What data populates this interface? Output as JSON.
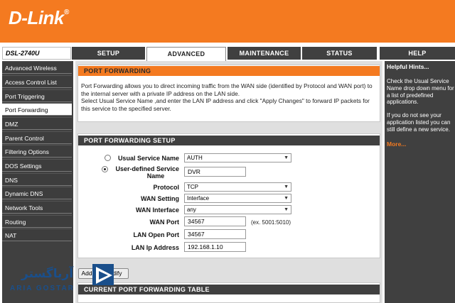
{
  "brand": {
    "logo": "D-Link",
    "logo_mark": "®"
  },
  "model": "DSL-2740U",
  "tabs": [
    {
      "label": "SETUP"
    },
    {
      "label": "ADVANCED"
    },
    {
      "label": "MAINTENANCE"
    },
    {
      "label": "STATUS"
    },
    {
      "label": "HELP"
    }
  ],
  "sidebar": {
    "items": [
      {
        "label": "Advanced Wireless"
      },
      {
        "label": "Access Control List"
      },
      {
        "label": "Port Triggering"
      },
      {
        "label": "Port Forwarding"
      },
      {
        "label": "DMZ"
      },
      {
        "label": "Parent Control"
      },
      {
        "label": "Filtering Options"
      },
      {
        "label": "DOS Settings"
      },
      {
        "label": "DNS"
      },
      {
        "label": "Dynamic DNS"
      },
      {
        "label": "Network Tools"
      },
      {
        "label": "Routing"
      },
      {
        "label": "NAT"
      }
    ]
  },
  "port_forwarding": {
    "title": "PORT FORWARDING",
    "intro_1": "Port Forwarding allows you to direct incoming traffic from the WAN side (identified by Protocol and WAN port) to the internal server with a private IP address on the LAN side.",
    "intro_2": "Select Usual Service Name ,and enter the LAN IP address and click \"Apply Changes\" to forward IP packets for this service to the specified server."
  },
  "setup": {
    "title": "PORT FORWARDING SETUP",
    "usual_service_label": "Usual Service Name",
    "usual_service_value": "AUTH",
    "user_defined_label_1": "User-defined Service",
    "user_defined_label_2": "Name",
    "user_defined_value": "DVR",
    "protocol_label": "Protocol",
    "protocol_value": "TCP",
    "wan_setting_label": "WAN Setting",
    "wan_setting_value": "Interface",
    "wan_interface_label": "WAN Interface",
    "wan_interface_value": "any",
    "wan_port_label": "WAN Port",
    "wan_port_value": "34567",
    "wan_port_hint": "(ex. 5001:5010)",
    "lan_open_port_label": "LAN Open Port",
    "lan_open_port_value": "34567",
    "lan_ip_label": "LAN Ip Address",
    "lan_ip_value": "192.168.1.10"
  },
  "buttons": {
    "add": "Add",
    "modify": "Modify"
  },
  "table": {
    "title": "CURRENT PORT FORWARDING TABLE"
  },
  "help": {
    "title": "Helpful Hints...",
    "text_1": "Check the Usual Service Name drop down menu for a list of predefined applications.",
    "text_2": "If you do not see your application listed you can still define a new service.",
    "more": "More..."
  },
  "watermark": {
    "text": "ARIA GOSTAR",
    "text_fa": "آریاگستر"
  },
  "colors": {
    "orange": "#f47a20",
    "dark": "#404040"
  }
}
